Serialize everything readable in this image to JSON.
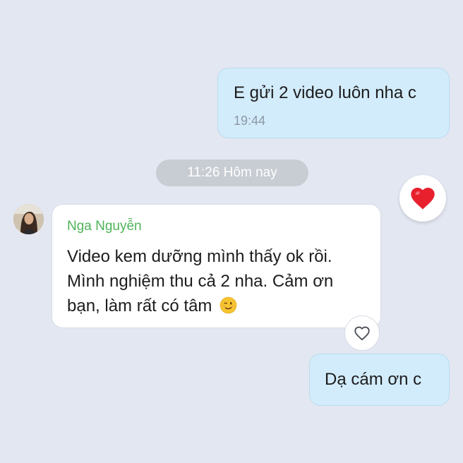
{
  "messages": {
    "outgoing_1": {
      "text": "E gửi 2 video luôn nha c",
      "time": "19:44"
    },
    "date_separator": "11:26 Hôm nay",
    "incoming_1": {
      "sender": "Nga Nguyễn",
      "lines": [
        "Video kem dưỡng mình thấy ok rồi.",
        "Mình nghiệm thu cả 2 nha. Cảm ơn",
        "bạn, làm rất có tâm"
      ],
      "emoji": "😉"
    },
    "outgoing_2": {
      "text": "Dạ cám ơn c"
    }
  },
  "reactions": {
    "given_icon": "red-heart-icon",
    "available_icon": "heart-outline-icon"
  },
  "colors": {
    "background": "#e3e7f1",
    "outgoing_bubble": "#d3ecfb",
    "incoming_bubble": "#ffffff",
    "sender_name": "#4fb35a",
    "date_pill": "#c8ccd3",
    "heart": "#e8202e"
  }
}
